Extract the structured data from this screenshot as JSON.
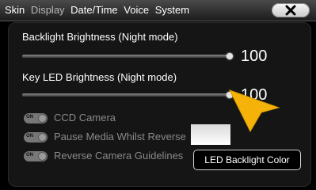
{
  "tabs": [
    "Skin",
    "Display",
    "Date/Time",
    "Voice",
    "System"
  ],
  "settings": {
    "backlight": {
      "label": "Backlight Brightness (Night mode)",
      "value": "100",
      "level_percent": 100
    },
    "key_led": {
      "label": "Key LED Brightness (Night mode)",
      "value": "100",
      "level_percent": 100
    }
  },
  "toggles": [
    {
      "label": "CCD Camera",
      "state_text": "ON"
    },
    {
      "label": "Pause Media Whilst Reverse",
      "state_text": "ON"
    },
    {
      "label": "Reverse Camera Guidelines",
      "state_text": "ON"
    }
  ],
  "led_button": {
    "label": "LED Backlight Color"
  },
  "colors": {
    "arrow": "#F5B30A",
    "swatch": "#FFFFFF",
    "background": "#000000"
  },
  "icons": {
    "close": "close-icon",
    "pointer": "arrow-pointer-icon"
  }
}
